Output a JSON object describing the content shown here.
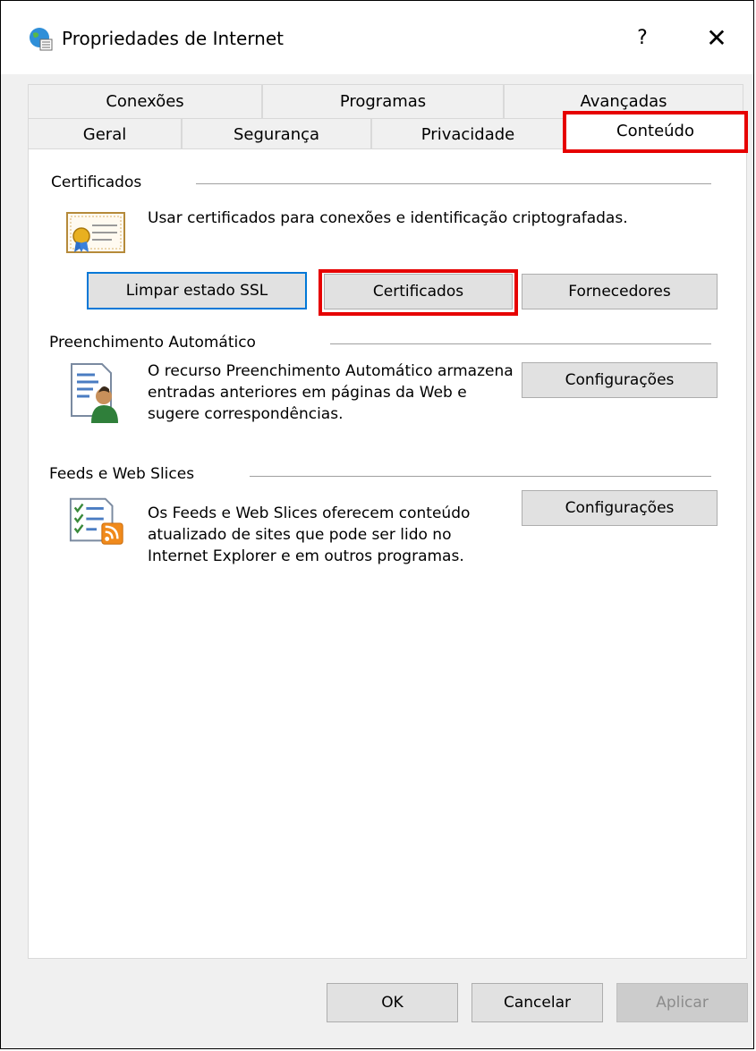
{
  "window": {
    "title": "Propriedades de Internet",
    "help_label": "?",
    "close_label": "✕"
  },
  "tabs": {
    "row1": [
      "Conexões",
      "Programas",
      "Avançadas"
    ],
    "row2": [
      "Geral",
      "Segurança",
      "Privacidade",
      "Conteúdo"
    ],
    "active": "Conteúdo"
  },
  "certificates": {
    "title": "Certificados",
    "description": "Usar certificados para conexões e identificação criptografadas.",
    "clear_ssl_label": "Limpar estado SSL",
    "certificates_label": "Certificados",
    "publishers_label": "Fornecedores",
    "icon": "certificate-icon"
  },
  "autocomplete": {
    "title": "Preenchimento Automático",
    "description": "O recurso Preenchimento Automático armazena entradas anteriores em páginas da Web e sugere correspondências.",
    "settings_label": "Configurações",
    "icon": "autocomplete-icon"
  },
  "feeds": {
    "title": "Feeds e Web Slices",
    "description": "Os Feeds e Web Slices oferecem conteúdo atualizado de sites que pode ser lido no Internet Explorer e em outros programas.",
    "settings_label": "Configurações",
    "icon": "rss-feed-icon"
  },
  "footer": {
    "ok_label": "OK",
    "cancel_label": "Cancelar",
    "apply_label": "Aplicar"
  },
  "colors": {
    "highlight": "#e60000",
    "focus_border": "#0078d7"
  }
}
